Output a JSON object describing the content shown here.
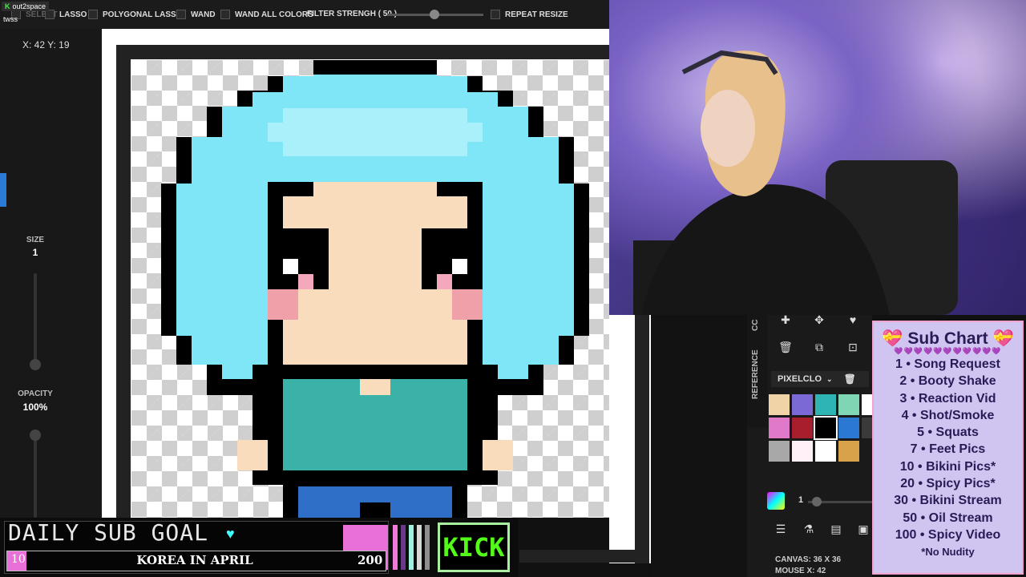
{
  "chat_badge": {
    "label": "out2space",
    "second_line": "twss"
  },
  "toolbar": {
    "items": [
      "SELECT",
      "LASSO",
      "POLYGONAL LASSO",
      "WAND",
      "WAND ALL COLORS",
      "FILTER STRENGH ( 50 )",
      "REPEAT RESIZE"
    ],
    "filter_strength": 50
  },
  "left_panel": {
    "coords": "X: 42 Y: 19",
    "size_label": "SIZE",
    "size_value": "1",
    "opacity_label": "OPACITY",
    "opacity_value": "100%"
  },
  "palette_panel": {
    "tab_top": "CC",
    "tab_reference": "REFERENCE",
    "palette_name": "PIXELCLO",
    "brush_size": "1",
    "canvas_info": "CANVAS: 36 X 36",
    "mouse_info": "MOUSE X: 42",
    "swatches": [
      "#f0d3a6",
      "#7b6ad6",
      "#2fb4b4",
      "#7fd6b4",
      "#ffffff",
      "#e07ac8",
      "#a81e2c",
      "#000000",
      "#2a78d2",
      "#3a3a3a",
      "#a8a8a8",
      "#fff0f8",
      "#ffffff",
      "#d8a24a"
    ]
  },
  "sub_chart": {
    "title": "Sub Chart",
    "hearts": "💜💜💜💜💜💜💜💜💜💜💜",
    "items": [
      "1 • Song Request",
      "2 • Booty Shake",
      "3 • Reaction Vid",
      "4 • Shot/Smoke",
      "5 • Squats",
      "7 • Feet Pics",
      "10 • Bikini Pics*",
      "20 • Spicy Pics*",
      "30 • Bikini Stream",
      "50 • Oil Stream",
      "100 • Spicy Video"
    ],
    "note": "*No Nudity"
  },
  "sub_goal": {
    "title": "DAILY SUB GOAL",
    "current": "10",
    "goal_name": "KOREA IN APRIL",
    "target": "200",
    "progress": 0.05,
    "kick_label": "KICK"
  },
  "colors": {
    "accent": "#f3a3cf",
    "kick": "#53fc18",
    "hair": "#7fe6f8",
    "shirt": "#3bb2a8",
    "pants": "#2f6fc8",
    "skin": "#f8dcbc"
  }
}
